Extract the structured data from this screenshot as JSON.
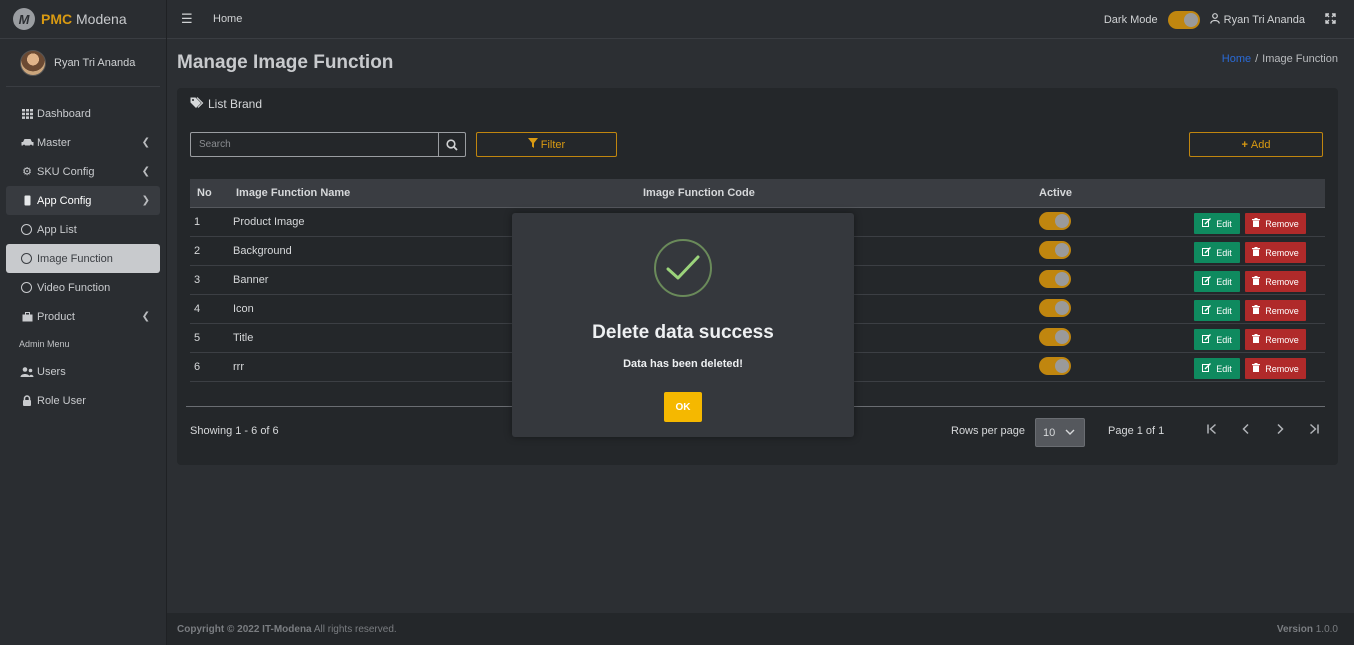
{
  "brand": {
    "logo_letter": "M",
    "name_highlight": "PMC",
    "name_rest": "Modena"
  },
  "user": {
    "name": "Ryan Tri Ananda"
  },
  "sidebar": {
    "items": [
      {
        "label": "Dashboard",
        "icon": "grid-icon"
      },
      {
        "label": "Master",
        "icon": "car-icon"
      },
      {
        "label": "SKU Config",
        "icon": "gear-icon"
      },
      {
        "label": "App Config",
        "icon": "phone-icon"
      },
      {
        "label": "App List"
      },
      {
        "label": "Image Function"
      },
      {
        "label": "Video Function"
      },
      {
        "label": "Product",
        "icon": "box-icon"
      }
    ],
    "admin_header": "Admin Menu",
    "admin_items": [
      {
        "label": "Users",
        "icon": "users-icon"
      },
      {
        "label": "Role User",
        "icon": "lock-icon"
      }
    ]
  },
  "topbar": {
    "home": "Home",
    "dark_mode_label": "Dark Mode",
    "user_name": "Ryan Tri Ananda"
  },
  "page": {
    "title": "Manage Image Function",
    "breadcrumb_home": "Home",
    "breadcrumb_sep": "/",
    "breadcrumb_current": "Image Function"
  },
  "card": {
    "title": "List Brand",
    "search_placeholder": "Search",
    "filter_label": "Filter",
    "add_label": "Add"
  },
  "table": {
    "headers": {
      "no": "No",
      "name": "Image Function Name",
      "code": "Image Function Code",
      "active": "Active"
    },
    "rows": [
      {
        "no": "1",
        "name": "Product Image",
        "code": "",
        "active": true
      },
      {
        "no": "2",
        "name": "Background",
        "code": "",
        "active": true
      },
      {
        "no": "3",
        "name": "Banner",
        "code": "",
        "active": true
      },
      {
        "no": "4",
        "name": "Icon",
        "code": "",
        "active": true
      },
      {
        "no": "5",
        "name": "Title",
        "code": "",
        "active": true
      },
      {
        "no": "6",
        "name": "rrr",
        "code": "",
        "active": true
      }
    ],
    "edit_label": "Edit",
    "remove_label": "Remove"
  },
  "pagination": {
    "showing": "Showing 1 - 6 of 6",
    "rows_per_page_label": "Rows per page",
    "rows_per_page_value": "10",
    "page_info": "Page 1 of 1"
  },
  "footer": {
    "copyright_prefix": "Copyright © 2022",
    "company": "IT-Modena",
    "rights": "All rights reserved.",
    "version_label": "Version",
    "version_value": "1.0.0"
  },
  "modal": {
    "title": "Delete data success",
    "message": "Data has been deleted!",
    "ok_label": "OK"
  },
  "colors": {
    "accent": "#c0860f",
    "edit": "#0f8a5f",
    "remove": "#b02a2a",
    "ok": "#f5b800",
    "link": "#2a6ad6"
  }
}
